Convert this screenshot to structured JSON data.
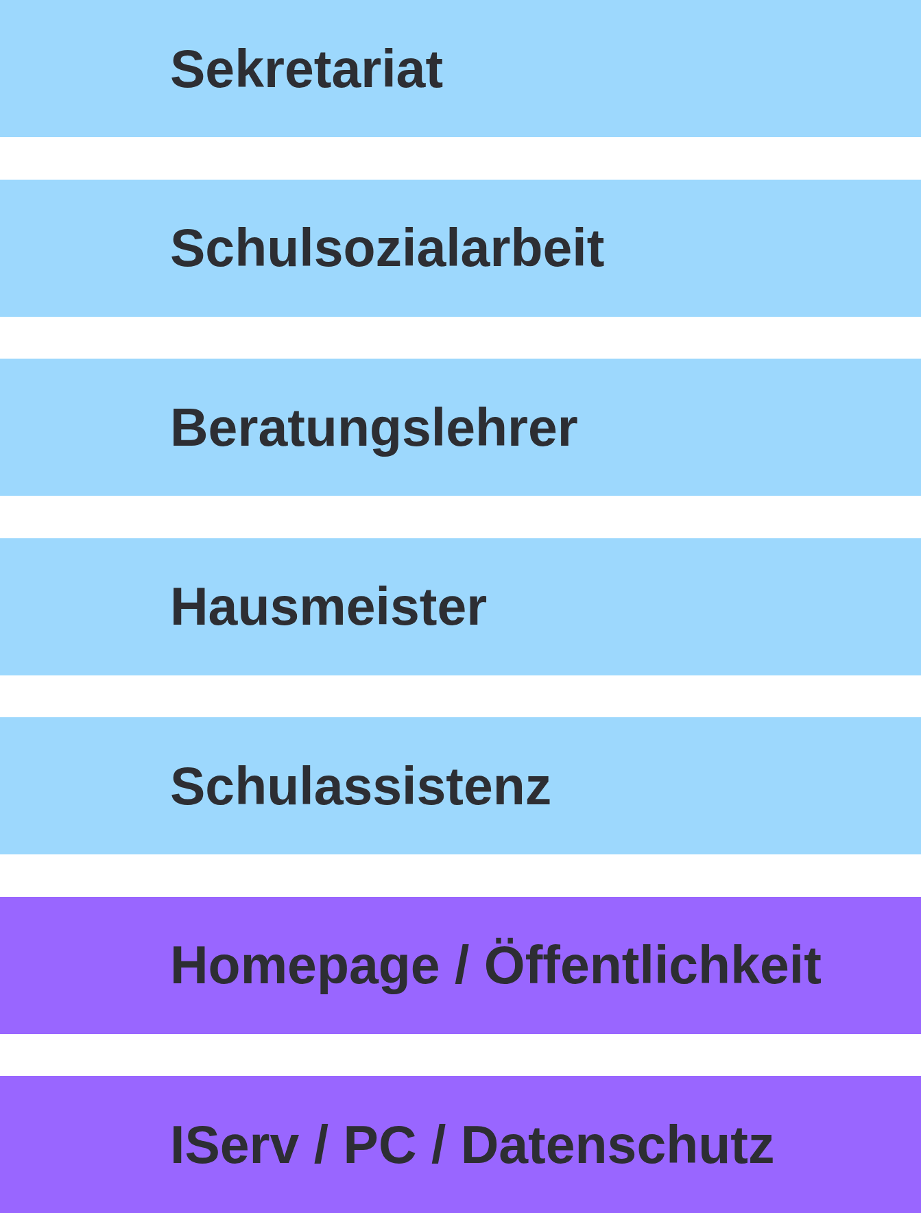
{
  "items": [
    {
      "label": "Sekretariat",
      "color": "#9dd8fd"
    },
    {
      "label": "Schulsozialarbeit",
      "color": "#9dd8fd"
    },
    {
      "label": "Beratungslehrer",
      "color": "#9dd8fd"
    },
    {
      "label": "Hausmeister",
      "color": "#9dd8fd"
    },
    {
      "label": "Schulassistenz",
      "color": "#9dd8fd"
    },
    {
      "label": "Homepage / Öffentlichkeit",
      "color": "#9966ff"
    },
    {
      "label": "IServ / PC / Datenschutz",
      "color": "#9966ff"
    }
  ]
}
